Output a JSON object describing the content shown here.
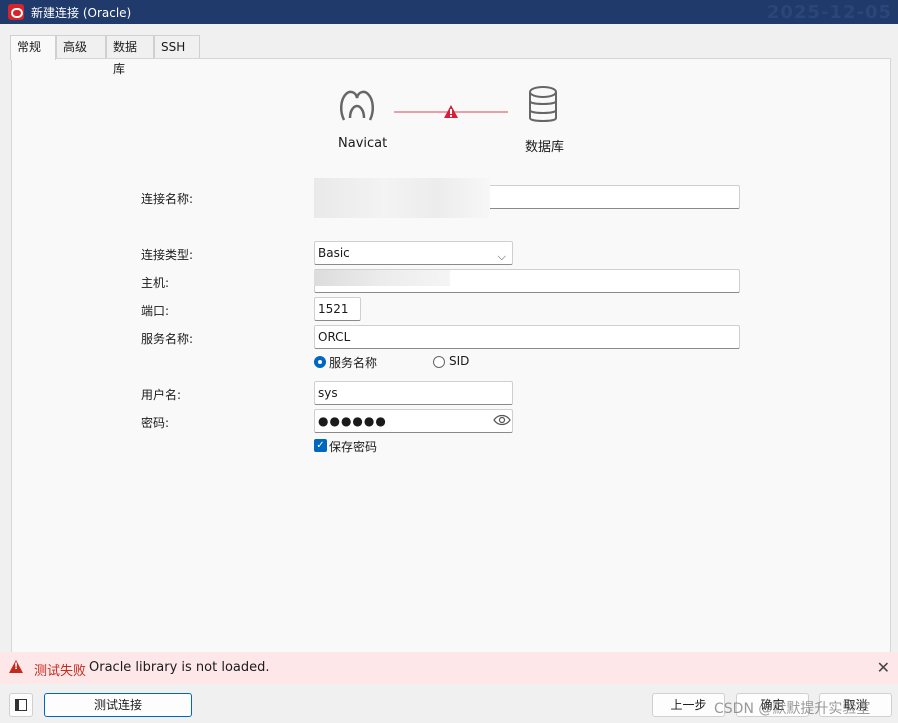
{
  "window": {
    "title": "新建连接 (Oracle)",
    "stamp": "2025-12-05"
  },
  "tabs": [
    {
      "label": "常规"
    },
    {
      "label": "高级"
    },
    {
      "label": "数据库"
    },
    {
      "label": "SSH"
    }
  ],
  "diagram": {
    "left_label": "Navicat",
    "right_label": "数据库"
  },
  "form": {
    "conn_name_label": "连接名称:",
    "conn_type_label": "连接类型:",
    "conn_type_value": "Basic",
    "host_label": "主机:",
    "port_label": "端口:",
    "port_value": "1521",
    "service_label": "服务名称:",
    "service_value": "ORCL",
    "radio_service_label": "服务名称",
    "radio_sid_label": "SID",
    "user_label": "用户名:",
    "user_value": "sys",
    "password_label": "密码:",
    "password_value": "●●●●●●",
    "save_password_label": "保存密码"
  },
  "status": {
    "fail_label": "测试失败",
    "message": "Oracle library is not loaded.",
    "accent": "#c42b1c"
  },
  "footer": {
    "test_button": "测试连接",
    "back_button": "上一步",
    "ok_button": "确定",
    "cancel_button": "取消",
    "watermark": "CSDN @默默提升实验室"
  }
}
